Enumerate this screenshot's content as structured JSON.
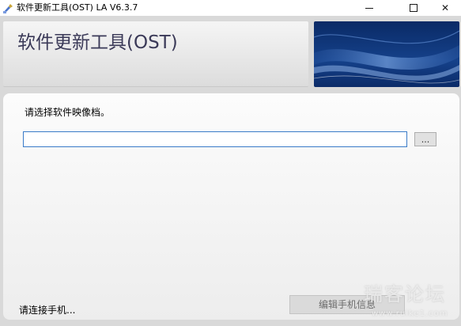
{
  "window": {
    "title": "软件更新工具(OST) LA V6.3.7",
    "minimize_icon": "minimize-icon",
    "maximize_icon": "maximize-icon",
    "close_icon": "close-icon",
    "close_glyph": "✕"
  },
  "header": {
    "title": "软件更新工具(OST)",
    "art_colors": [
      "#0c2f6e",
      "#1d4f9e",
      "#5f8fd0"
    ]
  },
  "main": {
    "instruction": "请选择软件映像档。",
    "file_path_value": "",
    "browse_label": "..."
  },
  "footer": {
    "status": "请连接手机...",
    "edit_button_label": "编辑手机信息"
  },
  "watermark": {
    "text": "瑞客论坛",
    "url": "www.ruike1.com"
  },
  "colors": {
    "banner_title": "#3b3a58",
    "input_border": "#3a7bc8",
    "disabled_text": "#6d6d6d"
  }
}
